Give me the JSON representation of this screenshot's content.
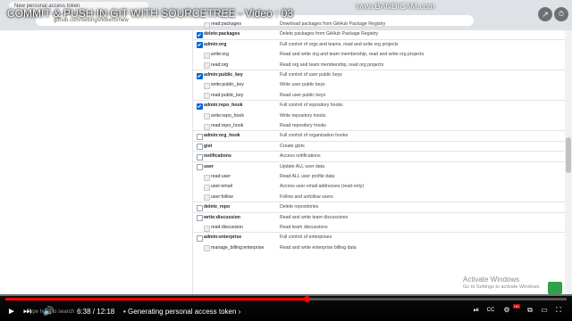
{
  "video": {
    "title": "COMMIT & PUSH IN GIT WITH SOURCETREE - Video : 03",
    "watermark": "www.BANDICAM.com",
    "time": "6:38 / 12:18",
    "chapter": "• Generating personal access token ›",
    "progress": 0.538,
    "controls": {
      "play": "►",
      "next": "⏭",
      "volume": "🔊",
      "autoplay": "⏯",
      "subtitles": "CC",
      "settings": "⚙",
      "miniplayer": "⧉",
      "theater": "▭",
      "fullscreen": "⛶",
      "hd": "HD"
    },
    "top_icons": {
      "share": "↗",
      "watch_later": "⏱"
    }
  },
  "browser": {
    "tab_title": "New personal access token",
    "url": "github.com/settings/tokens/new"
  },
  "scopes": [
    {
      "type": "child",
      "name": "read:packages",
      "desc": "Download packages from GitHub Package Registry",
      "checked": false
    },
    {
      "type": "parent",
      "name": "delete:packages",
      "desc": "Delete packages from GitHub Package Registry",
      "checked": true
    },
    {
      "type": "parent",
      "name": "admin:org",
      "desc": "Full control of orgs and teams, read and write org projects",
      "checked": true
    },
    {
      "type": "child",
      "name": "write:org",
      "desc": "Read and write org and team membership, read and write org projects",
      "checked": false
    },
    {
      "type": "child",
      "name": "read:org",
      "desc": "Read org and team membership, read org projects",
      "checked": false
    },
    {
      "type": "parent",
      "name": "admin:public_key",
      "desc": "Full control of user public keys",
      "checked": true
    },
    {
      "type": "child",
      "name": "write:public_key",
      "desc": "Write user public keys",
      "checked": false
    },
    {
      "type": "child",
      "name": "read:public_key",
      "desc": "Read user public keys",
      "checked": false
    },
    {
      "type": "parent",
      "name": "admin:repo_hook",
      "desc": "Full control of repository hooks",
      "checked": true
    },
    {
      "type": "child",
      "name": "write:repo_hook",
      "desc": "Write repository hooks",
      "checked": false
    },
    {
      "type": "child",
      "name": "read:repo_hook",
      "desc": "Read repository hooks",
      "checked": false
    },
    {
      "type": "parent",
      "name": "admin:org_hook",
      "desc": "Full control of organization hooks",
      "checked": false
    },
    {
      "type": "parent",
      "name": "gist",
      "desc": "Create gists",
      "checked": false
    },
    {
      "type": "parent",
      "name": "notifications",
      "desc": "Access notifications",
      "checked": false
    },
    {
      "type": "parent",
      "name": "user",
      "desc": "Update ALL user data",
      "checked": false
    },
    {
      "type": "child",
      "name": "read:user",
      "desc": "Read ALL user profile data",
      "checked": false
    },
    {
      "type": "child",
      "name": "user:email",
      "desc": "Access user email addresses (read-only)",
      "checked": false
    },
    {
      "type": "child",
      "name": "user:follow",
      "desc": "Follow and unfollow users",
      "checked": false
    },
    {
      "type": "parent",
      "name": "delete_repo",
      "desc": "Delete repositories",
      "checked": false
    },
    {
      "type": "parent",
      "name": "write:discussion",
      "desc": "Read and write team discussions",
      "checked": false
    },
    {
      "type": "child",
      "name": "read:discussion",
      "desc": "Read team discussions",
      "checked": false
    },
    {
      "type": "parent",
      "name": "admin:enterprise",
      "desc": "Full control of enterprises",
      "checked": false
    },
    {
      "type": "child",
      "name": "manage_billing:enterprise",
      "desc": "Read and write enterprise billing data",
      "checked": false
    }
  ],
  "windows": {
    "activate_title": "Activate Windows",
    "activate_sub": "Go to Settings to activate Windows.",
    "taskbar_hint": "Type here to search"
  }
}
